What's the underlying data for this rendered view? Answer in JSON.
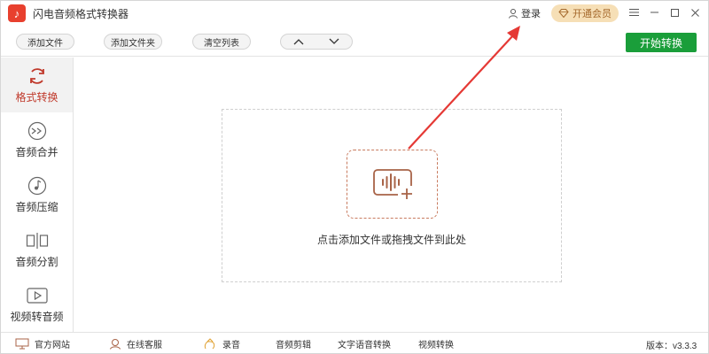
{
  "app": {
    "title": "闪电音频格式转换器",
    "logo_icon": "music-note-icon"
  },
  "titlebar": {
    "login_label": "登录",
    "vip_label": "开通会员"
  },
  "toolbar": {
    "add_file": "添加文件",
    "add_folder": "添加文件夹",
    "clear_list": "清空列表",
    "start_convert": "开始转换"
  },
  "sidebar": {
    "items": [
      {
        "label": "格式转换",
        "icon": "refresh-icon",
        "active": true
      },
      {
        "label": "音频合并",
        "icon": "merge-icon",
        "active": false
      },
      {
        "label": "音频压缩",
        "icon": "music-disc-icon",
        "active": false
      },
      {
        "label": "音频分割",
        "icon": "split-icon",
        "active": false
      },
      {
        "label": "视频转音频",
        "icon": "play-icon",
        "active": false
      }
    ]
  },
  "main": {
    "drop_hint": "点击添加文件或拖拽文件到此处"
  },
  "footer": {
    "website": "官方网站",
    "support": "在线客服",
    "record": "录音",
    "audio_edit": "音频剪辑",
    "tts": "文字语音转换",
    "video_convert": "视频转换",
    "version": "版本：v3.3.3"
  },
  "colors": {
    "accent": "#1a9e3a",
    "active": "#c0392b",
    "vip_bg": "#f6dfb6",
    "drop_border": "#c87b5f",
    "pointer": "#e53935"
  }
}
